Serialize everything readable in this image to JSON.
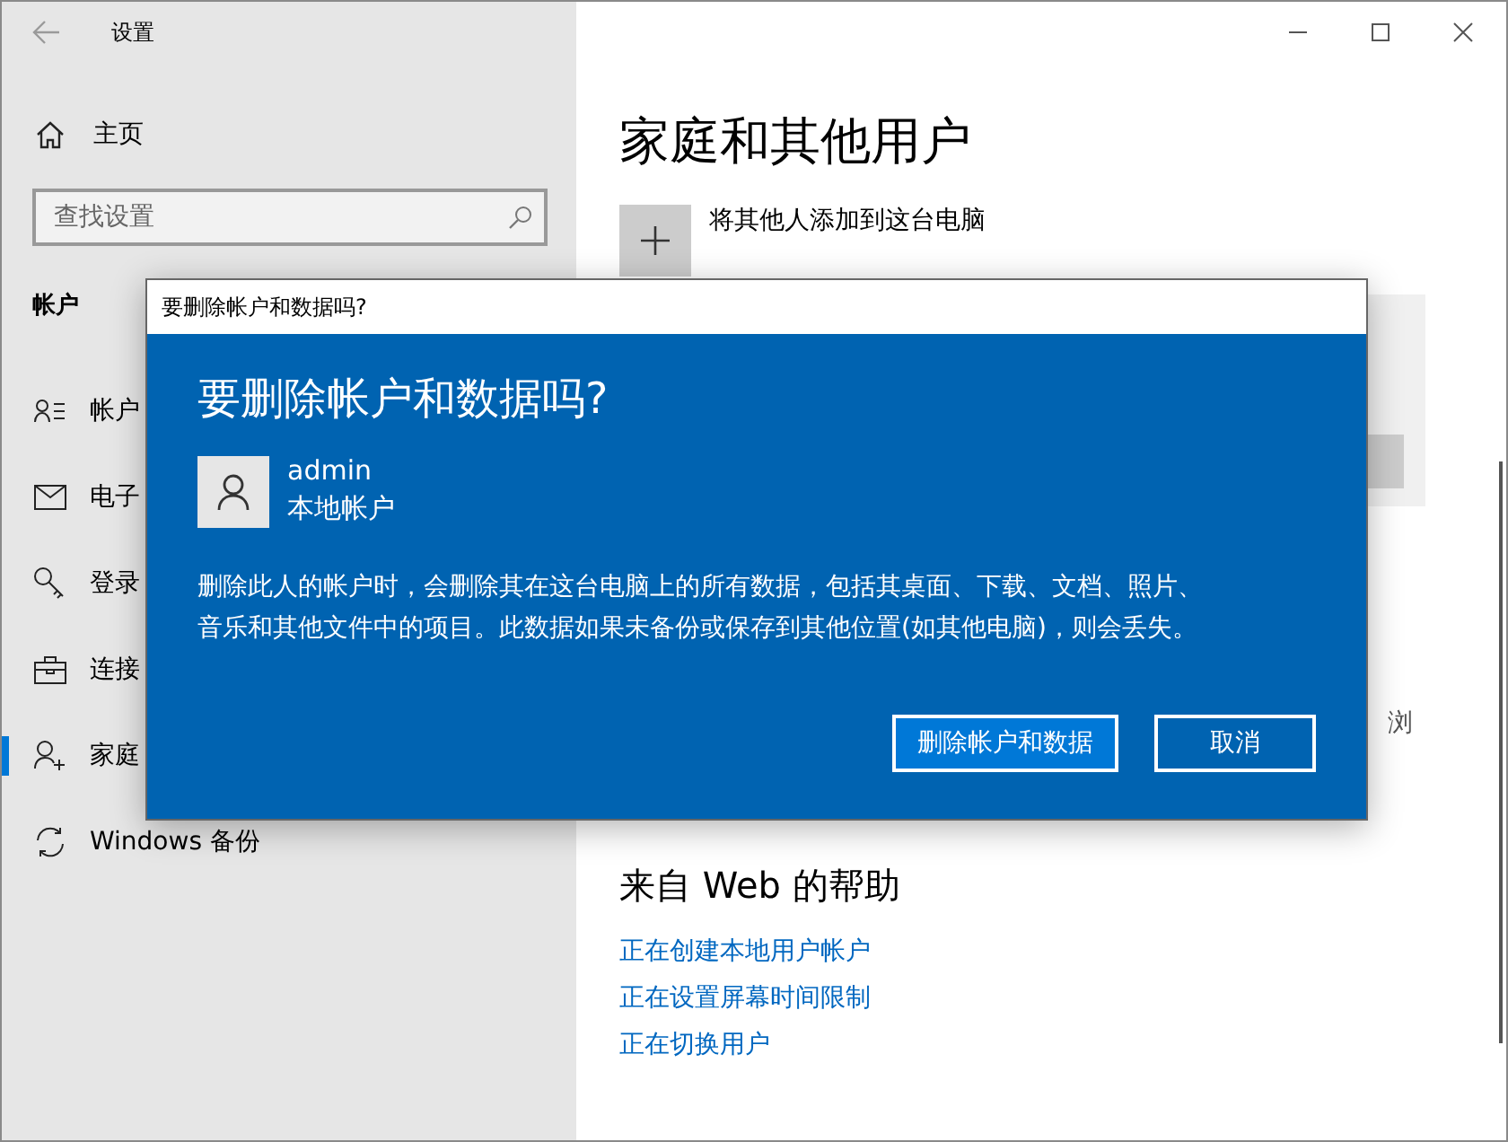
{
  "window": {
    "title": "设置"
  },
  "sidebar": {
    "home": "主页",
    "search": {
      "placeholder": "查找设置"
    },
    "section": "帐户",
    "items": [
      {
        "kind": "accounts",
        "label": "帐户",
        "selected": false
      },
      {
        "kind": "email",
        "label": "电子",
        "selected": false
      },
      {
        "kind": "signin",
        "label": "登录",
        "selected": false
      },
      {
        "kind": "work",
        "label": "连接",
        "selected": false
      },
      {
        "kind": "family",
        "label": "家庭",
        "selected": true
      },
      {
        "kind": "backup",
        "label": "Windows 备份",
        "selected": false
      }
    ]
  },
  "main": {
    "title": "家庭和其他用户",
    "add_label": "将其他人添加到这台电脑",
    "partial_text": "浏",
    "help_title": "来自 Web 的帮助",
    "links": [
      "正在创建本地用户帐户",
      "正在设置屏幕时间限制",
      "正在切换用户"
    ]
  },
  "dialog": {
    "title": "要删除帐户和数据吗?",
    "heading": "要删除帐户和数据吗?",
    "account": {
      "name": "admin",
      "type": "本地帐户"
    },
    "message": "删除此人的帐户时，会删除其在这台电脑上的所有数据，包括其桌面、下载、文档、照片、音乐和其他文件中的项目。此数据如果未备份或保存到其他位置(如其他电脑)，则会丢失。",
    "buttons": [
      {
        "label": "删除帐户和数据",
        "primary": true
      },
      {
        "label": "取消",
        "primary": false
      }
    ]
  }
}
